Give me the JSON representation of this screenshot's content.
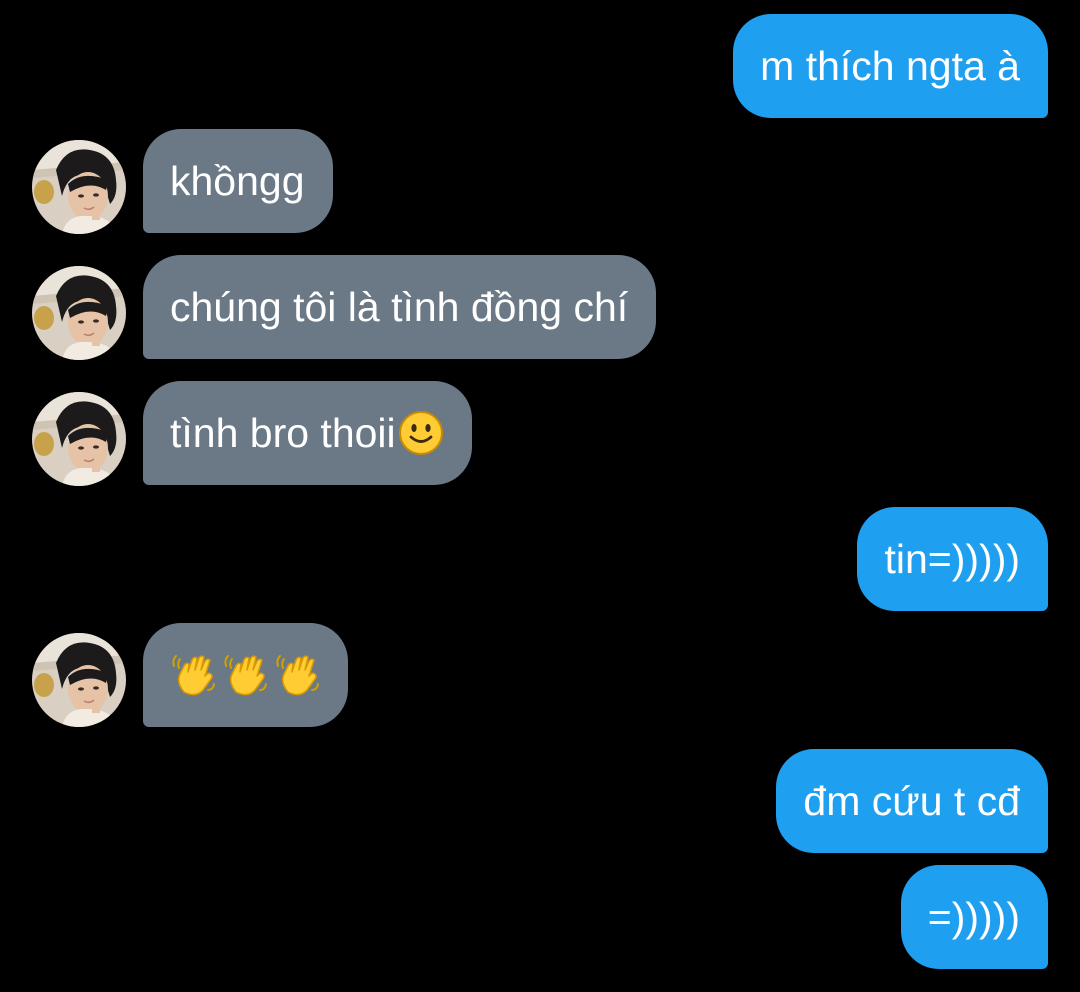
{
  "conversation": {
    "messages": [
      {
        "side": "sent",
        "text": "m thích ngta à"
      },
      {
        "side": "received",
        "text": "khồngg"
      },
      {
        "side": "received",
        "text": "chúng tôi là tình đồng chí"
      },
      {
        "side": "received",
        "text": "tình bro thoii",
        "emoji": "slightly-smiling-face"
      },
      {
        "side": "sent",
        "text": "tin=)))))"
      },
      {
        "side": "received",
        "text": "",
        "emoji": [
          "waving-hand",
          "waving-hand",
          "waving-hand"
        ]
      },
      {
        "side": "sent",
        "text": "đm cứu t cđ"
      },
      {
        "side": "sent",
        "text": "=)))))"
      }
    ]
  },
  "colors": {
    "background": "#000000",
    "sent_bubble": "#1f9ff0",
    "received_bubble": "#6b7886",
    "text": "#ffffff",
    "emoji_yellow": "#ffcc33"
  }
}
